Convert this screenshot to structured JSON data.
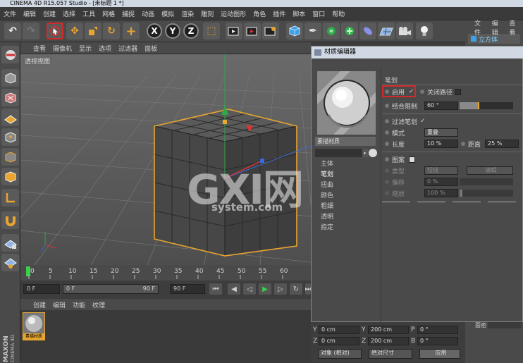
{
  "window": {
    "title": "CINEMA 4D R15.057 Studio - [未标题 1 *]"
  },
  "menu": [
    "文件",
    "编辑",
    "创建",
    "选择",
    "工具",
    "网格",
    "捕捉",
    "动画",
    "模拟",
    "渲染",
    "雕刻",
    "运动图形",
    "角色",
    "插件",
    "脚本",
    "窗口",
    "帮助"
  ],
  "right_panel": {
    "tabs": [
      "文件",
      "编辑",
      "查看"
    ],
    "object": "立方体",
    "attr_label": "面密"
  },
  "viewport": {
    "menu": [
      "查看",
      "摄像机",
      "显示",
      "选项",
      "过滤器",
      "面板"
    ],
    "label": "透视视图"
  },
  "timeline": {
    "ticks": [
      "0",
      "5",
      "10",
      "15",
      "20",
      "25",
      "30",
      "35",
      "40",
      "45",
      "50",
      "55",
      "60"
    ]
  },
  "transport": {
    "start": "0 F",
    "current": "0 F",
    "range_end": "90 F",
    "end": "90 F"
  },
  "material_manager": {
    "menu": [
      "创建",
      "编辑",
      "功能",
      "纹理"
    ],
    "material_name": "素描材质"
  },
  "coords": {
    "rows": [
      {
        "a": "Y",
        "av": "0 cm",
        "b": "Y",
        "bv": "200 cm",
        "c": "P",
        "cv": "0 °"
      },
      {
        "a": "Z",
        "av": "0 cm",
        "b": "Z",
        "bv": "200 cm",
        "c": "B",
        "cv": "0 °"
      }
    ],
    "mode1": "对象 (相对)",
    "mode2": "绝对尺寸",
    "apply": "应用"
  },
  "dialog": {
    "title": "材质编辑器",
    "material_name": "素描材质",
    "channels": [
      "主体",
      "笔划",
      "扭曲",
      "颜色",
      "粗细",
      "透明",
      "指定"
    ],
    "section": "笔划",
    "enable_label": "启用",
    "enable_check": "✓",
    "close_path_label": "关闭路径",
    "combine_label": "结合限制",
    "combine_value": "60 °",
    "filter_label": "过滤笔划",
    "filter_check": "✓",
    "mode_label": "模式",
    "mode_value": "重叠",
    "length_label": "长度",
    "length_value": "10 %",
    "distance_label": "距离",
    "distance_value": "25 %",
    "pattern_label": "图案",
    "type_label": "类型",
    "type_value": "短线",
    "edit_button": "编辑",
    "offset_label": "偏移",
    "offset_value": "0 %",
    "scale_label": "缩放",
    "scale_value": "100 %"
  },
  "watermark": {
    "main": "GXI网",
    "sub": "system.com"
  },
  "brand": {
    "maxon": "MAXON",
    "c4d": "CINEMA 4D"
  },
  "colors": {
    "accent": "#e8a530",
    "highlight": "#d12a2a"
  }
}
